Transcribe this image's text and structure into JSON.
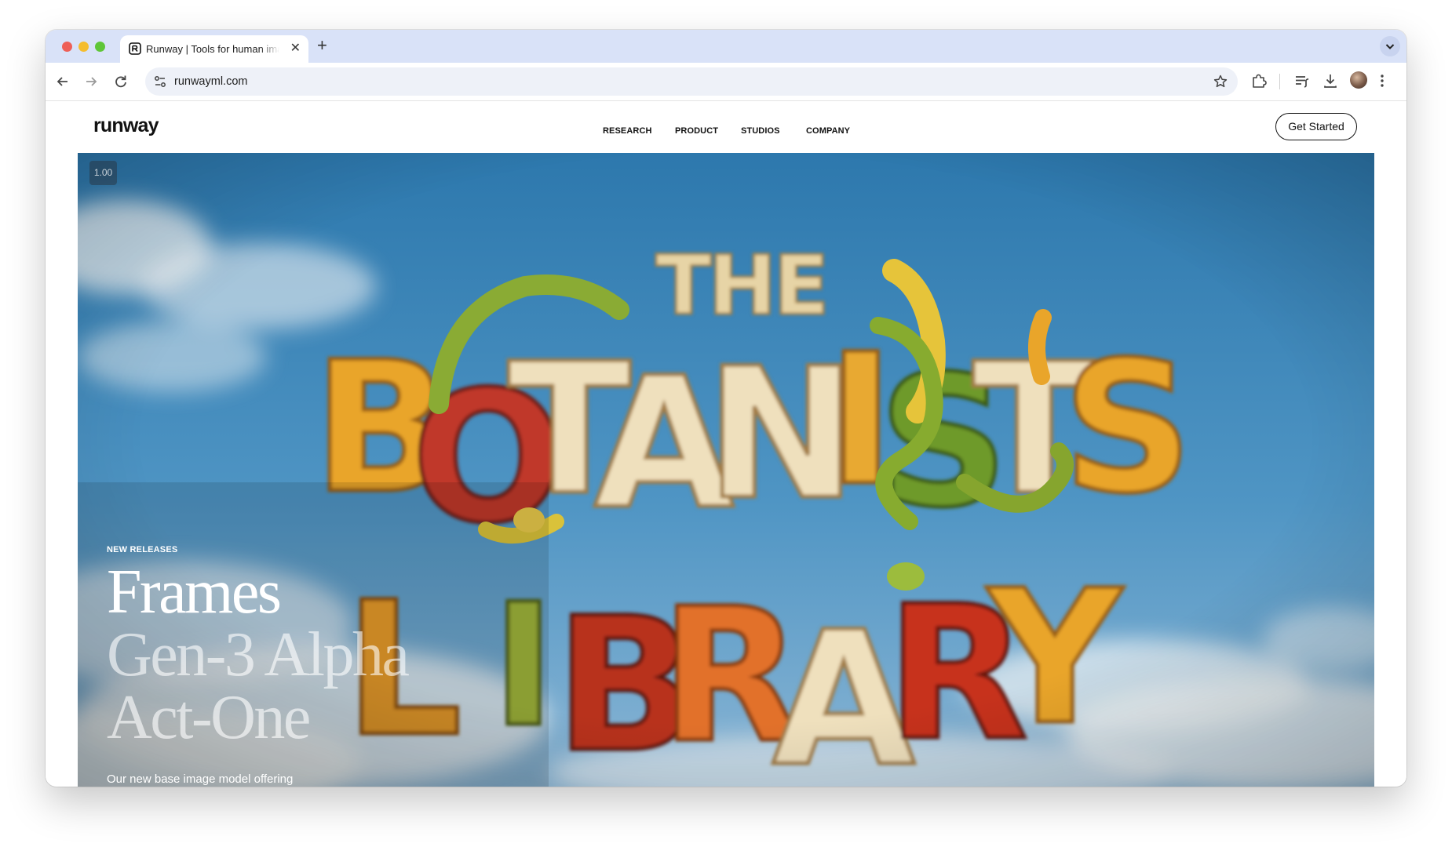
{
  "browser": {
    "tab_title": "Runway | Tools for human imagination",
    "new_tab_label": "+",
    "close_tab_label": "✕",
    "url": "runwayml.com"
  },
  "site": {
    "logo": "runway",
    "nav": [
      "RESEARCH",
      "PRODUCT",
      "STUDIOS",
      "COMPANY"
    ],
    "cta": "Get Started"
  },
  "hero": {
    "playback_rate": "1.00",
    "eyebrow": "NEW RELEASES",
    "releases": [
      "Frames",
      "Gen-3 Alpha",
      "Act-One"
    ],
    "description": "Our new base image model offering"
  },
  "colors": {
    "tabbar": "#d9e2f8",
    "sky_top": "#2d78ad",
    "sky_bottom": "#8ab5d4",
    "yellow_letters": "#e9a52a",
    "red_letters": "#b8331f",
    "orange_letters": "#e2712a"
  }
}
